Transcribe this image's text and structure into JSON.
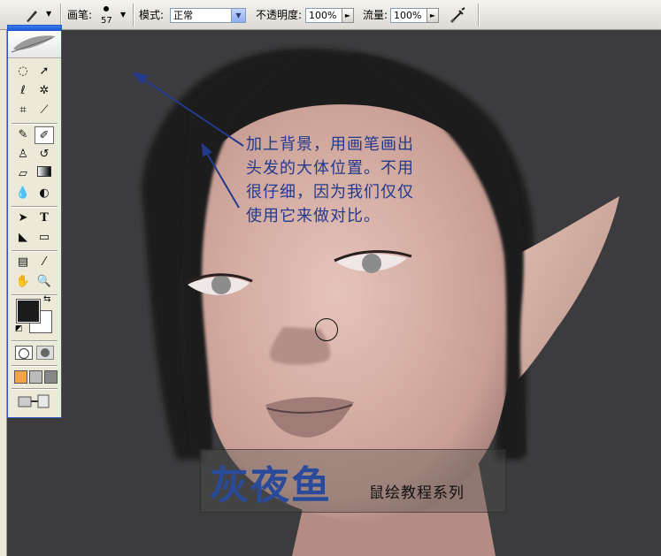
{
  "options_bar": {
    "brush_label": "画笔:",
    "brush_size": "57",
    "mode_label": "模式:",
    "mode_value": "正常",
    "opacity_label": "不透明度:",
    "opacity_value": "100%",
    "flow_label": "流量:",
    "flow_value": "100%"
  },
  "annotation": {
    "line1": "加上背景，用画笔画出",
    "line2": "头发的大体位置。不用",
    "line3": "很仔细，因为我们仅仅",
    "line4": "使用它来做对比。"
  },
  "brand": {
    "title": "灰夜鱼",
    "subtitle": "鼠绘教程系列"
  },
  "colors": {
    "foreground": "#1c1c1c",
    "background": "#ffffff",
    "canvas_bg": "#3c3c3e",
    "hair": "#1a1a1a",
    "skin": "#d9b1a7",
    "annotation": "#233a8d"
  },
  "toolbox": {
    "tools": [
      "marquee-icon",
      "move-icon",
      "lasso-icon",
      "magic-wand-icon",
      "crop-icon",
      "slice-icon",
      "healing-brush-icon",
      "brush-icon",
      "clone-stamp-icon",
      "history-brush-icon",
      "eraser-icon",
      "gradient-icon",
      "blur-icon",
      "dodge-icon",
      "path-select-icon",
      "type-icon",
      "pen-icon",
      "shape-icon",
      "notes-icon",
      "eyedropper-icon",
      "hand-icon",
      "zoom-icon"
    ]
  }
}
